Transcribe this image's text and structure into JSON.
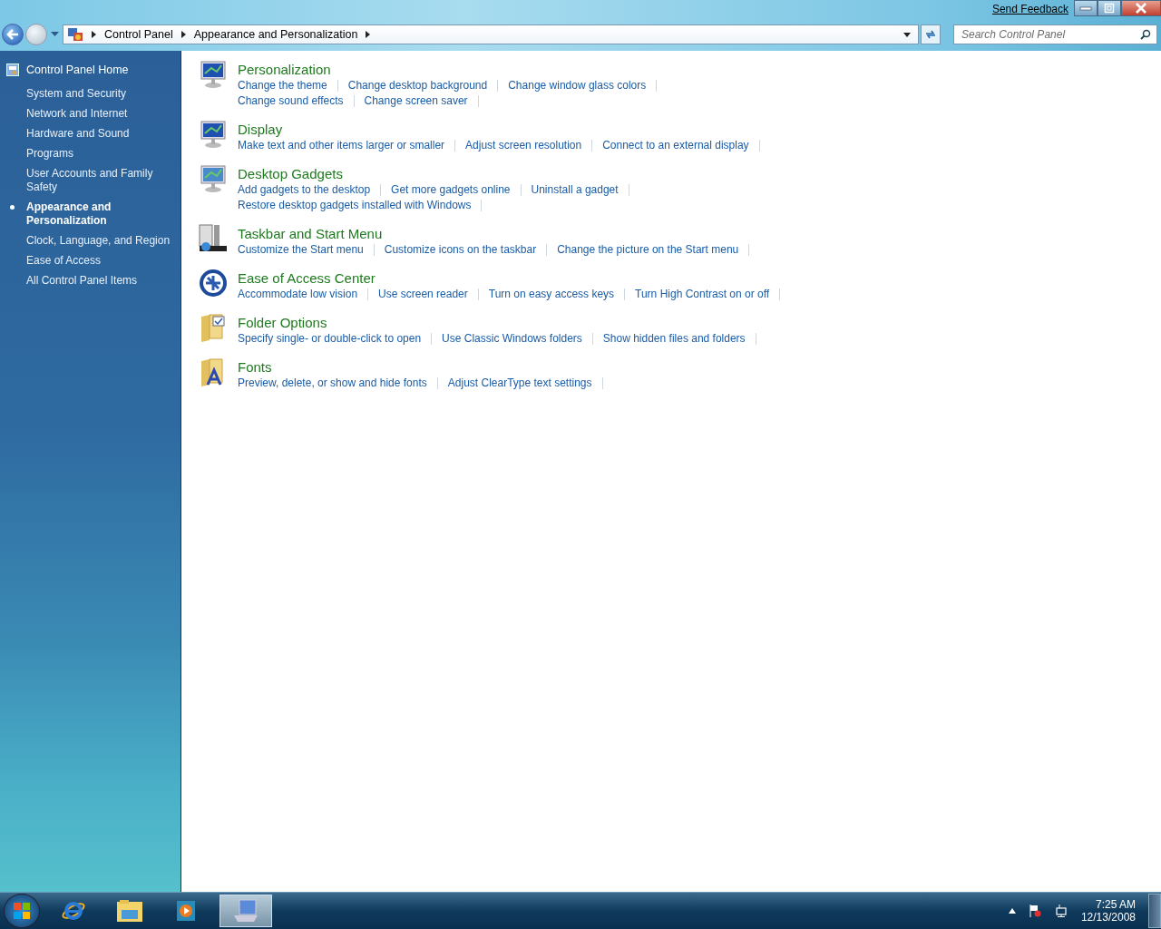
{
  "title_bar": {
    "feedback_link": "Send Feedback"
  },
  "address_bar": {
    "breadcrumbs": [
      "Control Panel",
      "Appearance and Personalization"
    ]
  },
  "search": {
    "placeholder": "Search Control Panel"
  },
  "sidebar": {
    "home": "Control Panel Home",
    "items": [
      {
        "label": "System and Security",
        "selected": false
      },
      {
        "label": "Network and Internet",
        "selected": false
      },
      {
        "label": "Hardware and Sound",
        "selected": false
      },
      {
        "label": "Programs",
        "selected": false
      },
      {
        "label": "User Accounts and Family Safety",
        "selected": false
      },
      {
        "label": "Appearance and Personalization",
        "selected": true
      },
      {
        "label": "Clock, Language, and Region",
        "selected": false
      },
      {
        "label": "Ease of Access",
        "selected": false
      },
      {
        "label": "All Control Panel Items",
        "selected": false
      }
    ]
  },
  "sections": [
    {
      "kind": "monitor",
      "title": "Personalization",
      "links": [
        "Change the theme",
        "Change desktop background",
        "Change window glass colors",
        "Change sound effects",
        "Change screen saver"
      ]
    },
    {
      "kind": "display",
      "title": "Display",
      "links": [
        "Make text and other items larger or smaller",
        "Adjust screen resolution",
        "Connect to an external display"
      ]
    },
    {
      "kind": "gadgets",
      "title": "Desktop Gadgets",
      "links": [
        "Add gadgets to the desktop",
        "Get more gadgets online",
        "Uninstall a gadget",
        "Restore desktop gadgets installed with Windows"
      ]
    },
    {
      "kind": "taskbar",
      "title": "Taskbar and Start Menu",
      "links": [
        "Customize the Start menu",
        "Customize icons on the taskbar",
        "Change the picture on the Start menu"
      ]
    },
    {
      "kind": "access",
      "title": "Ease of Access Center",
      "links": [
        "Accommodate low vision",
        "Use screen reader",
        "Turn on easy access keys",
        "Turn High Contrast on or off"
      ]
    },
    {
      "kind": "folder",
      "title": "Folder Options",
      "links": [
        "Specify single- or double-click to open",
        "Use Classic Windows folders",
        "Show hidden files and folders"
      ]
    },
    {
      "kind": "fonts",
      "title": "Fonts",
      "links": [
        "Preview, delete, or show and hide fonts",
        "Adjust ClearType text settings"
      ]
    }
  ],
  "taskbar": {
    "items": [
      {
        "kind": "browser",
        "selected": false
      },
      {
        "kind": "explorer",
        "selected": false
      },
      {
        "kind": "media",
        "selected": false
      },
      {
        "kind": "control",
        "selected": true
      }
    ],
    "clock": {
      "time": "7:25 AM",
      "date": "12/13/2008"
    }
  }
}
